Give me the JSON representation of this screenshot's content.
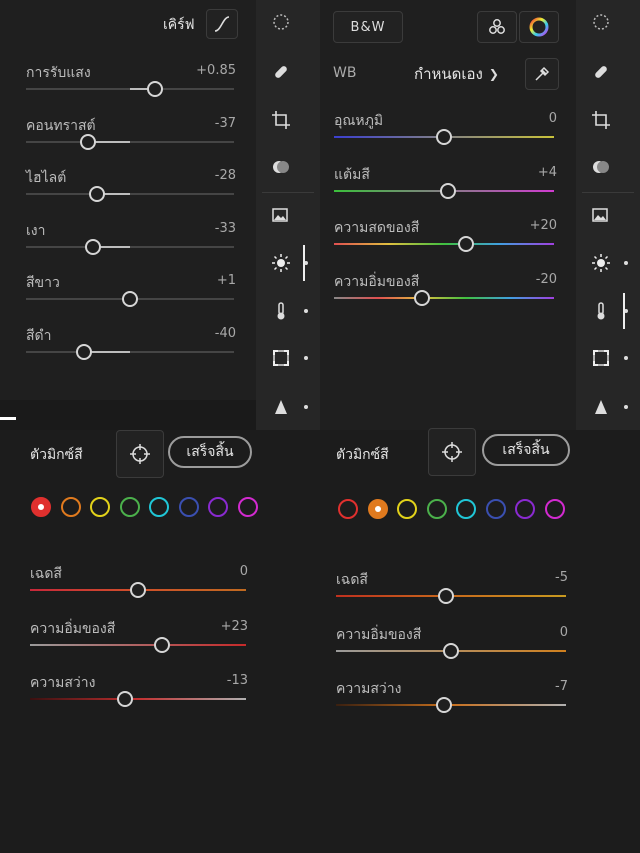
{
  "left": {
    "header_title": "เคิร์ฟ",
    "sliders": [
      {
        "label": "การรับแสง",
        "value": "+0.85",
        "pos": 0.62
      },
      {
        "label": "คอนทราสต์",
        "value": "-37",
        "pos": 0.3
      },
      {
        "label": "ไฮไลต์",
        "value": "-28",
        "pos": 0.34
      },
      {
        "label": "เงา",
        "value": "-33",
        "pos": 0.32
      },
      {
        "label": "สีขาว",
        "value": "+1",
        "pos": 0.5
      },
      {
        "label": "สีดำ",
        "value": "-40",
        "pos": 0.28
      }
    ],
    "mixer": {
      "title": "ตัวมิกซ์สี",
      "done_label": "เสร็จสิ้น",
      "selected_color": "red",
      "sliders": [
        {
          "label": "เฉดสี",
          "value": "0",
          "pos": 0.5
        },
        {
          "label": "ความอิ่มของสี",
          "value": "+23",
          "pos": 0.61
        },
        {
          "label": "ความสว่าง",
          "value": "-13",
          "pos": 0.44
        }
      ]
    }
  },
  "right": {
    "bw_label": "B&W",
    "wb_label": "WB",
    "wb_mode": "กำหนดเอง",
    "sliders": [
      {
        "label": "อุณหภูมิ",
        "value": "0",
        "pos": 0.5
      },
      {
        "label": "แต้มสี",
        "value": "+4",
        "pos": 0.52
      },
      {
        "label": "ความสดของสี",
        "value": "+20",
        "pos": 0.6
      },
      {
        "label": "ความอิ่มของสี",
        "value": "-20",
        "pos": 0.4
      }
    ],
    "mixer": {
      "title": "ตัวมิกซ์สี",
      "done_label": "เสร็จสิ้น",
      "selected_color": "orange",
      "sliders": [
        {
          "label": "เฉดสี",
          "value": "-5",
          "pos": 0.48
        },
        {
          "label": "ความอิ่มของสี",
          "value": "0",
          "pos": 0.5
        },
        {
          "label": "ความสว่าง",
          "value": "-7",
          "pos": 0.47
        }
      ]
    }
  },
  "color_swatches": [
    "#e0302e",
    "#e07a1e",
    "#e2d21a",
    "#4bb04b",
    "#20c6d6",
    "#3a4fb0",
    "#8a2ad0",
    "#d22ad0"
  ],
  "rail_icons": [
    "selective-icon",
    "healing-icon",
    "crop-icon",
    "masking-icon",
    "presets-icon",
    "light-icon",
    "color-icon",
    "optics-icon",
    "geometry-icon"
  ]
}
